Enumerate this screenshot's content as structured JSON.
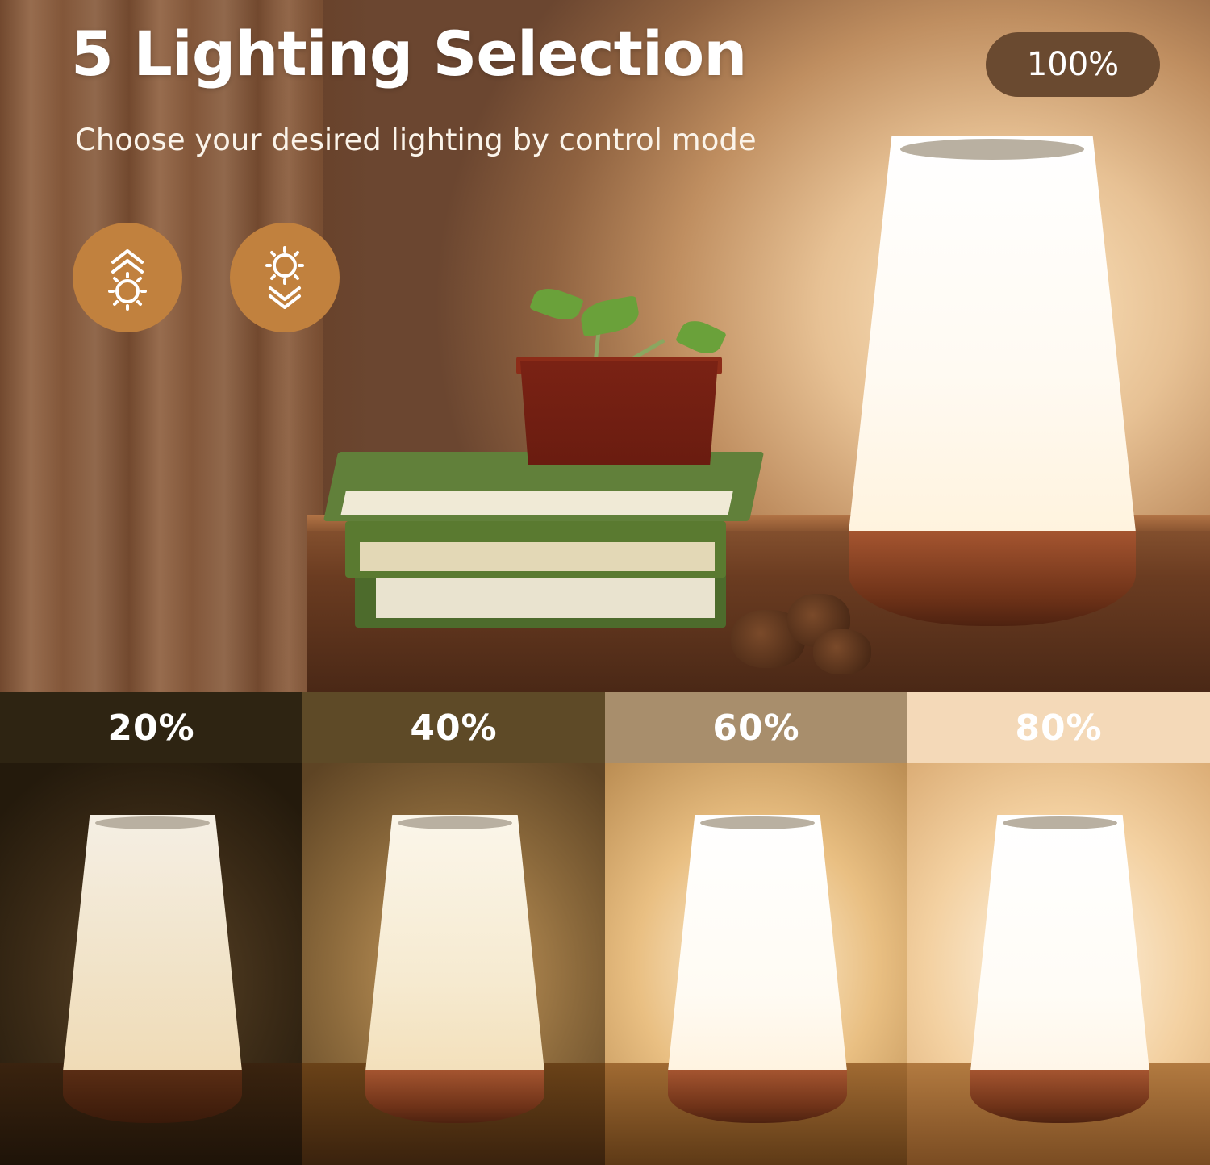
{
  "hero": {
    "title": "5 Lighting Selection",
    "subtitle": "Choose your desired lighting by control mode",
    "badge": "100%",
    "controls": [
      {
        "icon": "brightness-up-icon"
      },
      {
        "icon": "brightness-down-icon"
      }
    ]
  },
  "levels": [
    {
      "label": "20%",
      "brightness": 0.2
    },
    {
      "label": "40%",
      "brightness": 0.4
    },
    {
      "label": "60%",
      "brightness": 0.6
    },
    {
      "label": "80%",
      "brightness": 0.8
    }
  ],
  "colors": {
    "badge_bg": "#6a4a30",
    "control_bg": "#c1813e",
    "text": "#ffffff"
  }
}
